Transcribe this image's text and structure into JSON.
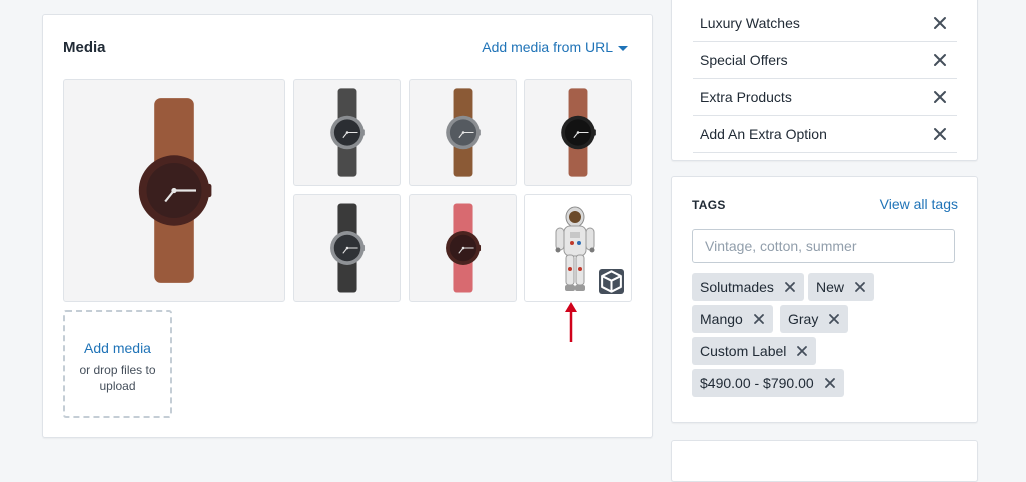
{
  "media": {
    "title": "Media",
    "add_from_url": "Add media from URL",
    "dropzone_title": "Add media",
    "dropzone_hint": "or drop files to upload",
    "items": [
      {
        "kind": "watch",
        "strap": "#9a5a3c",
        "case": "#4a2420",
        "dial": "#3a1f1e"
      },
      {
        "kind": "watch",
        "strap": "#4b4b4b",
        "case": "#8a8d91",
        "dial": "#2b2e33"
      },
      {
        "kind": "watch",
        "strap": "#8b5a36",
        "case": "#8a8d91",
        "dial": "#555a60"
      },
      {
        "kind": "watch",
        "strap": "#a5604a",
        "case": "#222222",
        "dial": "#121212"
      },
      {
        "kind": "watch",
        "strap": "#3a3a3a",
        "case": "#8f9296",
        "dial": "#2f3236"
      },
      {
        "kind": "watch",
        "strap": "#d86a70",
        "case": "#4a2420",
        "dial": "#341a1a"
      },
      {
        "kind": "model3d",
        "badge_icon": "cube-icon"
      }
    ]
  },
  "collections": [
    {
      "label": "Luxury Watches"
    },
    {
      "label": "Special Offers"
    },
    {
      "label": "Extra Products"
    },
    {
      "label": "Add An Extra Option"
    }
  ],
  "tags_panel": {
    "title": "TAGS",
    "view_all": "View all tags",
    "placeholder": "Vintage, cotton, summer",
    "tags": [
      "Solutmades",
      "New",
      "Mango",
      "Gray",
      "Custom Label",
      "$490.00 - $790.00"
    ]
  },
  "colors": {
    "link": "#1f73b7",
    "annotation_arrow": "#d0021b"
  }
}
